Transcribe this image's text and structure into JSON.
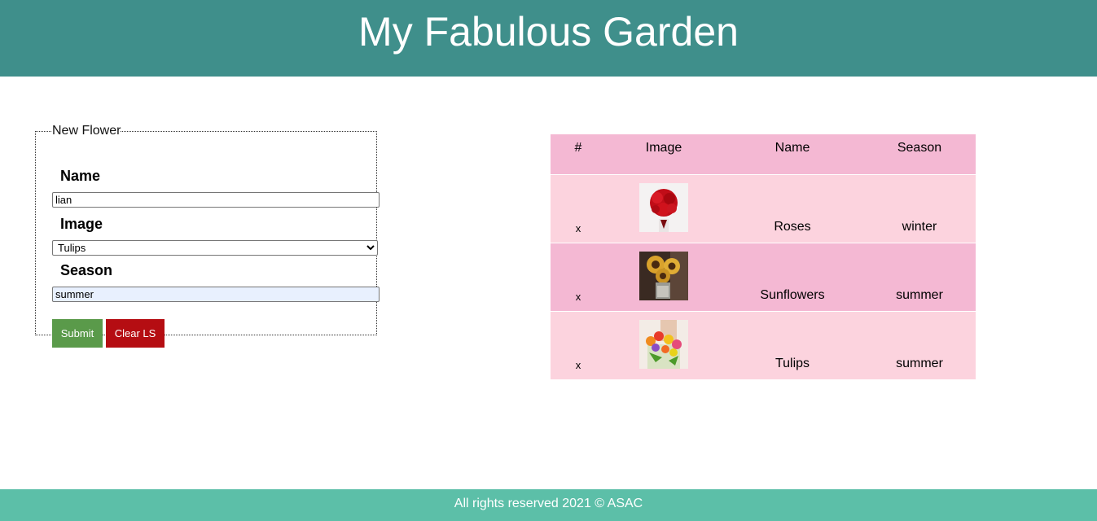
{
  "header": {
    "title": "My Fabulous Garden"
  },
  "form": {
    "legend": "New Flower",
    "name_label": "Name",
    "name_value": "lian",
    "image_label": "Image",
    "image_selected": "Tulips",
    "season_label": "Season",
    "season_value": "summer",
    "submit_label": "Submit",
    "clear_label": "Clear LS"
  },
  "table": {
    "headers": [
      "#",
      "Image",
      "Name",
      "Season"
    ],
    "rows": [
      {
        "remove": "x",
        "image_icon": "red-roses-thumbnail",
        "name": "Roses",
        "season": "winter"
      },
      {
        "remove": "x",
        "image_icon": "sunflowers-thumbnail",
        "name": "Sunflowers",
        "season": "summer"
      },
      {
        "remove": "x",
        "image_icon": "tulips-thumbnail",
        "name": "Tulips",
        "season": "summer"
      }
    ]
  },
  "footer": {
    "text": "All rights reserved 2021 © ASAC"
  },
  "colors": {
    "header_bg": "#3f8f8b",
    "footer_bg": "#5cbfa8",
    "table_header_bg": "#f4b8d3",
    "table_row_light": "#fcd3de",
    "submit_bg": "#5a9a4a",
    "clear_bg": "#b50d12"
  }
}
